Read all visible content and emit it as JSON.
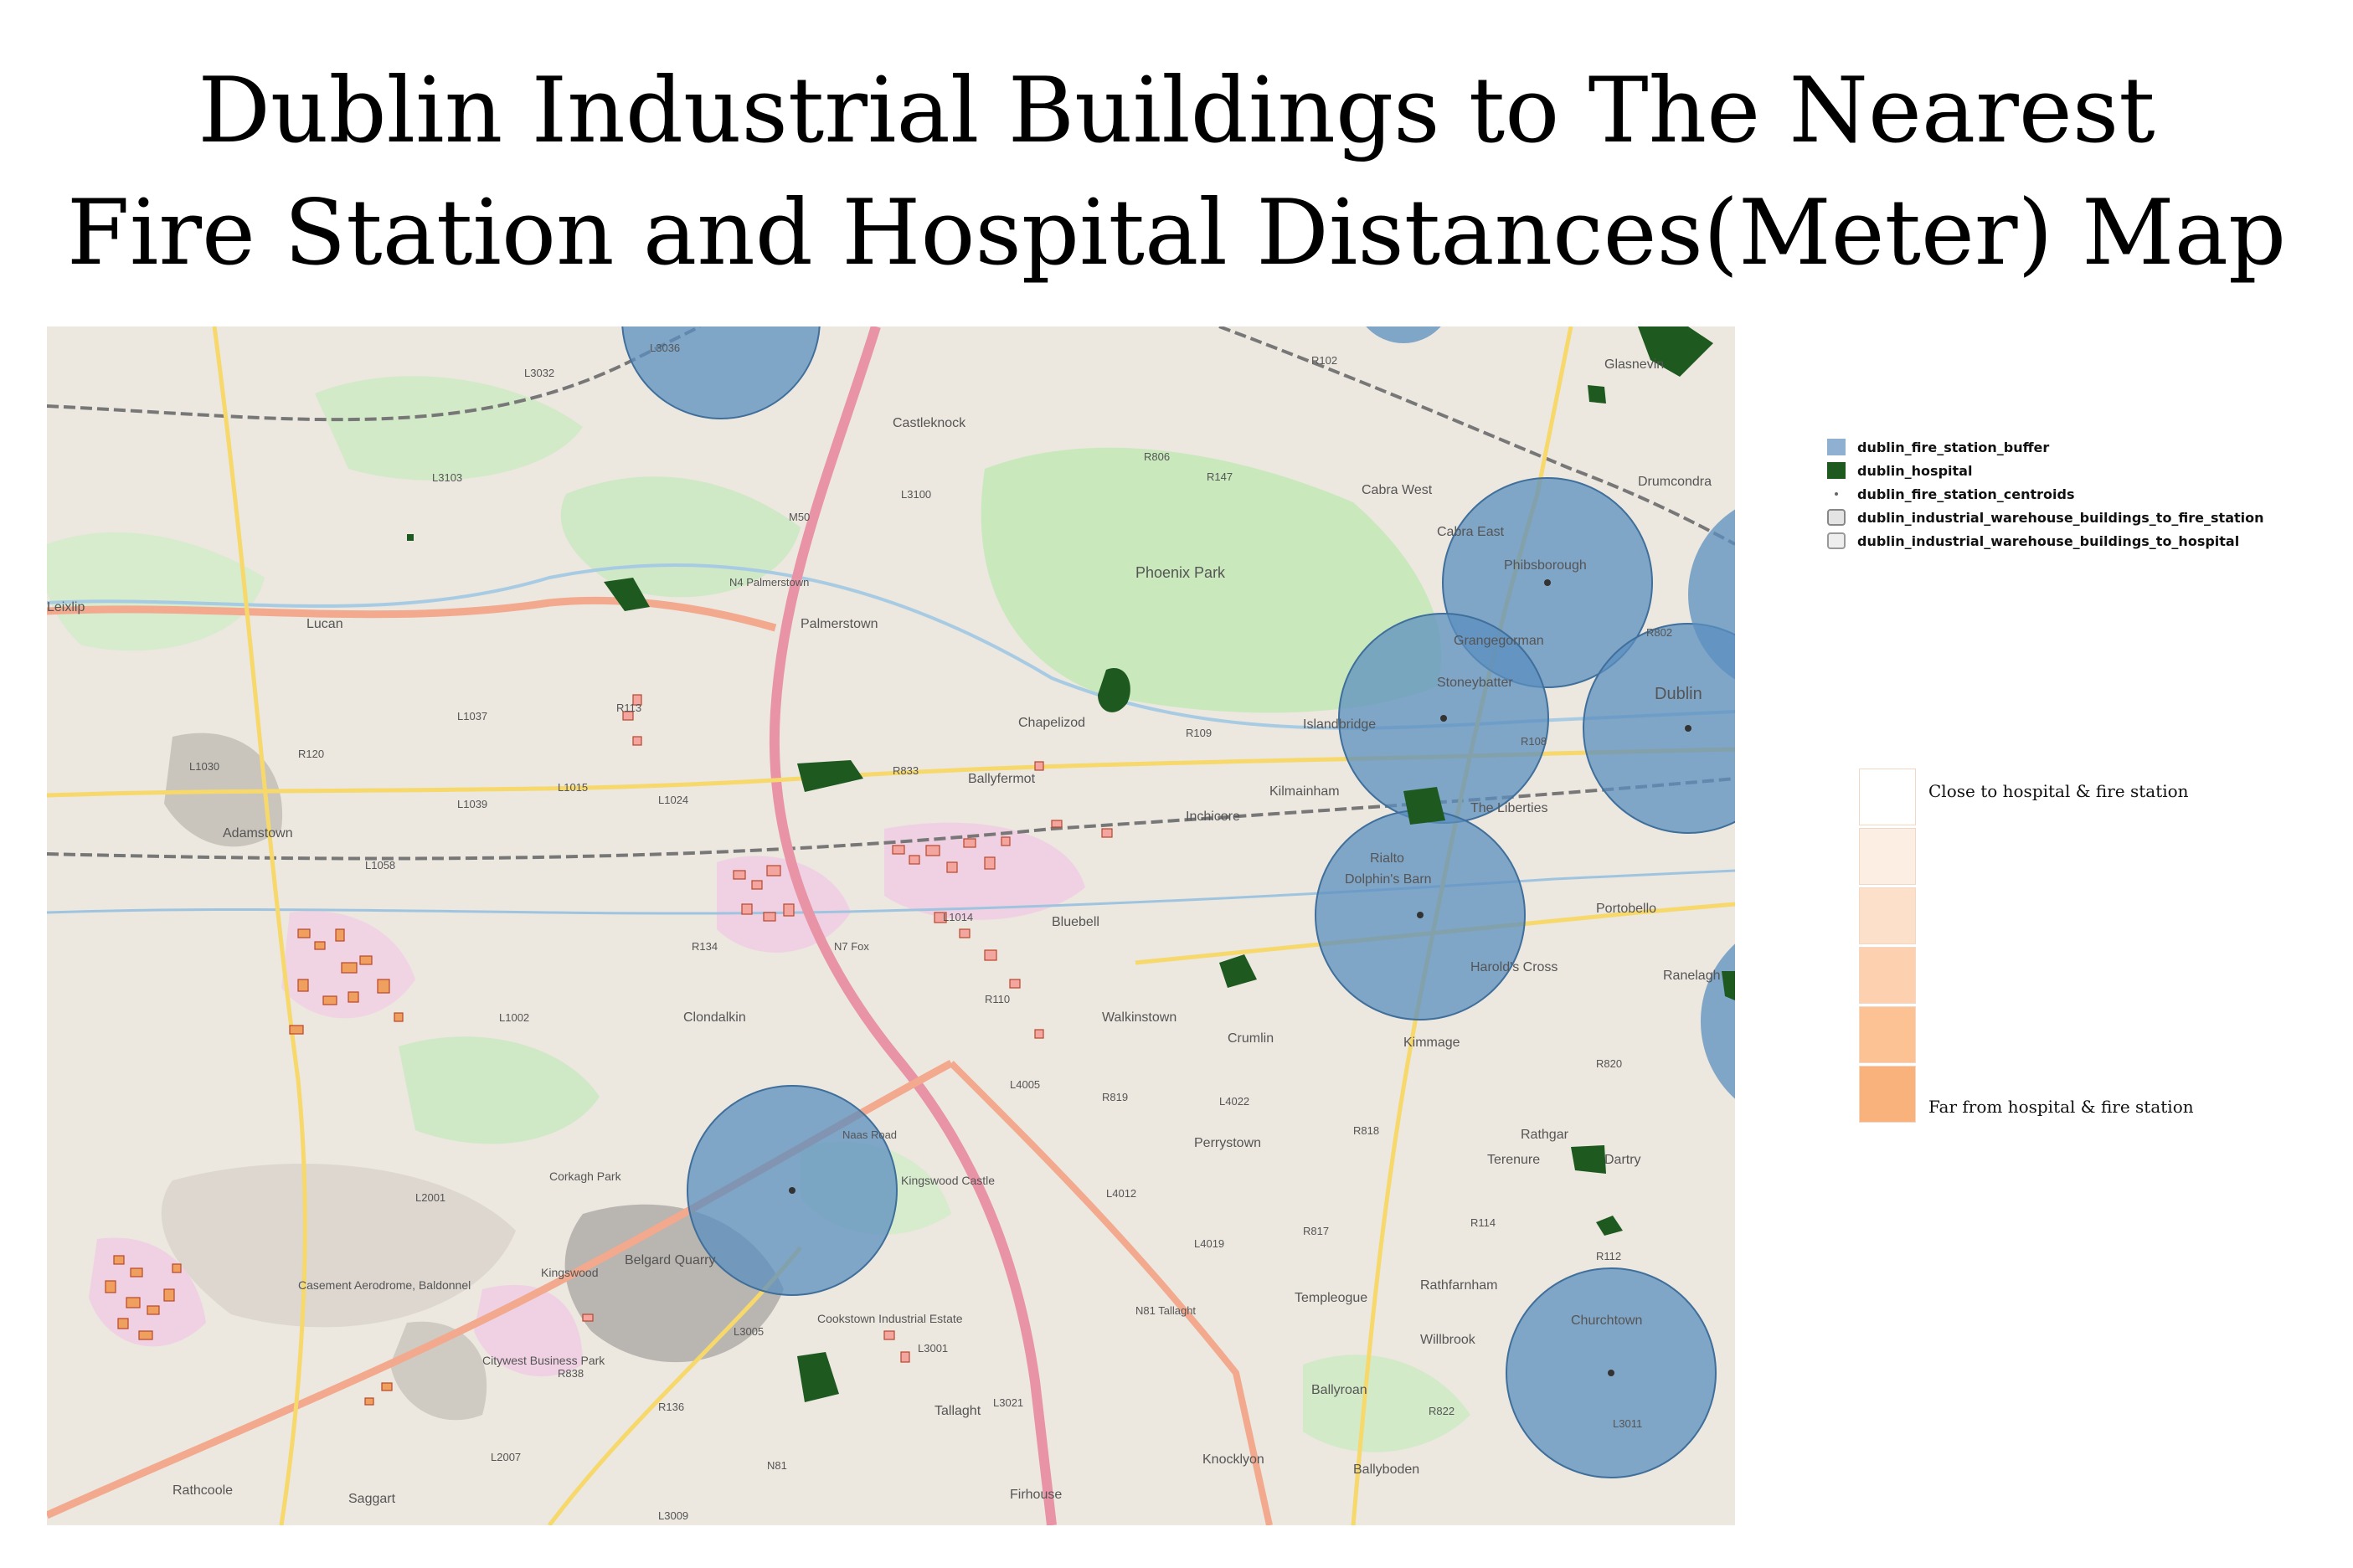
{
  "title": {
    "line1": "Dublin Industrial Buildings to The Nearest",
    "line2": "Fire Station and Hospital Distances(Meter) Map"
  },
  "map": {
    "place_labels": [
      "Castleknock",
      "Cabra West",
      "Cabra East",
      "Phibsborough",
      "Drumcondra",
      "Glasnevin",
      "Grangegorman",
      "Stoneybatter",
      "Dublin",
      "Islandbridge",
      "Kilmainham",
      "The Liberties",
      "Inchicore",
      "Rialto",
      "Dolphin's Barn",
      "Portobello",
      "Harold's Cross",
      "Ranelagh",
      "Ballyfermot",
      "Chapelizod",
      "Palmerstown",
      "Lucan",
      "Adamstown",
      "Clondalkin",
      "Bluebell",
      "Walkinstown",
      "Crumlin",
      "Kimmage",
      "Terenure",
      "Rathgar",
      "Dartry",
      "Perrystown",
      "Templeogue",
      "Rathfarnham",
      "Churchtown",
      "Willbrook",
      "Ballyroan",
      "Ballyboden",
      "Knocklyon",
      "Firhouse",
      "Tallaght",
      "Saggart",
      "Rathcoole",
      "Belgard Quarry",
      "Cookstown Industrial Estate",
      "Citywest Business Park",
      "Casement Aerodrome, Baldonnel",
      "Corkagh Park",
      "Kingswood",
      "Kingswood Castle",
      "Phoenix Park",
      "Leixlip"
    ],
    "road_labels": [
      "M50",
      "N4 Palmerstown",
      "N7 Fox",
      "N81 Tallaght",
      "Naas Road",
      "L3032",
      "L3005",
      "L3103",
      "L3100",
      "R806",
      "R147",
      "R102",
      "R109",
      "R833",
      "L1037",
      "L1015",
      "L1024",
      "L1039",
      "L1030",
      "L1058",
      "R120",
      "R113",
      "R134",
      "L1014",
      "R110",
      "L1002",
      "L4005",
      "R819",
      "L4022",
      "R818",
      "R817",
      "L4012",
      "L4019",
      "R114",
      "R112",
      "R820",
      "R822",
      "L3011",
      "R136",
      "L2007",
      "N81",
      "L3009",
      "R838",
      "L2001",
      "L3001",
      "L3021",
      "R108",
      "L3036",
      "R802"
    ]
  },
  "legend": {
    "layers": [
      {
        "label": "dublin_fire_station_buffer",
        "color": "#8fb0d0"
      },
      {
        "label": "dublin_hospital",
        "color": "#1e5a20"
      },
      {
        "label": "dublin_fire_station_centroids",
        "color": "#666666"
      },
      {
        "label": "dublin_industrial_warehouse_buildings_to_fire_station",
        "color": "#d8d8d8"
      },
      {
        "label": "dublin_industrial_warehouse_buildings_to_hospital",
        "color": "#e2e2e2"
      }
    ],
    "gradient": [
      {
        "label": "Close to hospital & fire station",
        "color": "#ffffff"
      },
      {
        "label": "",
        "color": "#fdeee3"
      },
      {
        "label": "",
        "color": "#fde0ca"
      },
      {
        "label": "",
        "color": "#fdd0af"
      },
      {
        "label": "",
        "color": "#fcc293"
      },
      {
        "label": "Far from hospital & fire station",
        "color": "#fab27c"
      }
    ]
  }
}
